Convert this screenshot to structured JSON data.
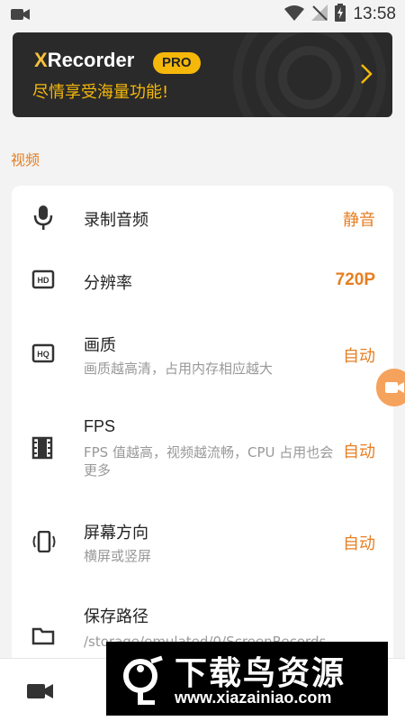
{
  "status_bar": {
    "time": "13:58"
  },
  "banner": {
    "logo_x": "X",
    "logo_rest": "Recorder",
    "badge": "PRO",
    "subtitle": "尽情享受海量功能!"
  },
  "section": {
    "title": "视频"
  },
  "settings": [
    {
      "title": "录制音频",
      "subtitle": "",
      "value": "静音",
      "icon": "microphone-icon"
    },
    {
      "title": "分辨率",
      "subtitle": "",
      "value": "720P",
      "icon": "hd-icon"
    },
    {
      "title": "画质",
      "subtitle": "画质越高清，占用内存相应越大",
      "value": "自动",
      "icon": "hq-icon"
    },
    {
      "title": "FPS",
      "subtitle": "FPS 值越高，视频越流畅，CPU 占用也会更多",
      "value": "自动",
      "icon": "film-icon"
    },
    {
      "title": "屏幕方向",
      "subtitle": "横屏或竖屏",
      "value": "自动",
      "icon": "screen-rotation-icon"
    },
    {
      "title": "保存路径",
      "subtitle": "/storage/emulated/0/ScreenRecords",
      "value": "",
      "icon": "folder-icon"
    }
  ],
  "watermark": {
    "title": "下载鸟资源",
    "url": "www.xiazainiao.com"
  },
  "colors": {
    "accent": "#e67e22",
    "banner_bg": "#2a2a2a",
    "pro": "#f5b80a"
  }
}
